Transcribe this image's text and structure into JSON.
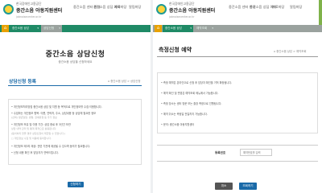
{
  "left_panel": {
    "logo": {
      "subtitle": "한국장애인고용공단",
      "title": "중간소음 아동지원센터",
      "url": "jobnoisecenter.or.kr"
    },
    "nav": [
      "중간소음 센터 안내",
      "중간소음 상담 예약",
      "자료마당",
      "알림마당"
    ],
    "tabs": [
      "중간소음 상담",
      "상담신청"
    ],
    "hero": {
      "title": "중간소음 상담신청",
      "subtitle": "중간소음 상담을 신청하세요"
    },
    "section": {
      "title": "상담신청 등록",
      "breadcrumb": "⌂ 중간소음 상담 > 상담신청"
    },
    "items": [
      "• 개인정보처리방침 중간소음 상담 및 지원 등 목적으로 개인정보를 수집·이용합니다.",
      "• 수집하는 개인정보 항목: 이름, 연락처, 주소, 상담내용 등 상담에 필요한 정보",
      "  (선택) 생년월일, 성별, 장애유형 등 추가 정보",
      "• 개인정보 보유 및 이용 기간: 상담 종료 후 3년간 보관",
      "  상담 내역 관리 및 통계 목적으로 활용됩니다.",
      "  (동의하지 않을 경우 상담신청이 제한될 수 있습니다.)",
      "  □ 개인정보 수집 및 이용에 동의합니다.",
      "• 개인정보 제3자 제공: 관련 기관에 제공될 수 있으며 동의가 필요합니다.",
      "• 신청 내용 확인 후 담당자가 연락드립니다."
    ],
    "submit_label": "신청하기"
  },
  "right_panel": {
    "logo": {
      "subtitle": "한국장애인고용공단",
      "title": "중간소음 아동지원센터",
      "url": "jobnoisecenter.or.kr"
    },
    "nav": [
      "중간소음 센터 안내",
      "중간소음 상담 예약",
      "자료마당",
      "알림마당"
    ],
    "tabs": [
      "중간소음 상담",
      "예약조회"
    ],
    "section": {
      "title": "측정신청 예약",
      "breadcrumb": "⌂ 중간소음 상담 > 예약조회"
    },
    "items": [
      "• 측정 예약은 온라인으로 신청 후 담당자 확인을 거쳐 확정됩니다.",
      "• 예약 확인 및 변경은 예약조회 메뉴에서 가능합니다.",
      "• 측정 장소는 센터 방문 또는 출장 측정으로 진행됩니다.",
      "• 예약 취소는 측정일 전일까지 가능합니다.",
      "• 문의: 중간소음 아동지원센터"
    ],
    "field": {
      "label": "등록번호",
      "placeholder": "예약번호를 입력"
    },
    "cancel_label": "취소",
    "confirm_label": "조회하기"
  },
  "colors": {
    "primary_green": "#1f8a66",
    "tab_gray": "#9aa29e",
    "accent_blue": "#1a6aa8",
    "home_orange": "#e8a100",
    "accent_bar": "#7fb24a"
  }
}
